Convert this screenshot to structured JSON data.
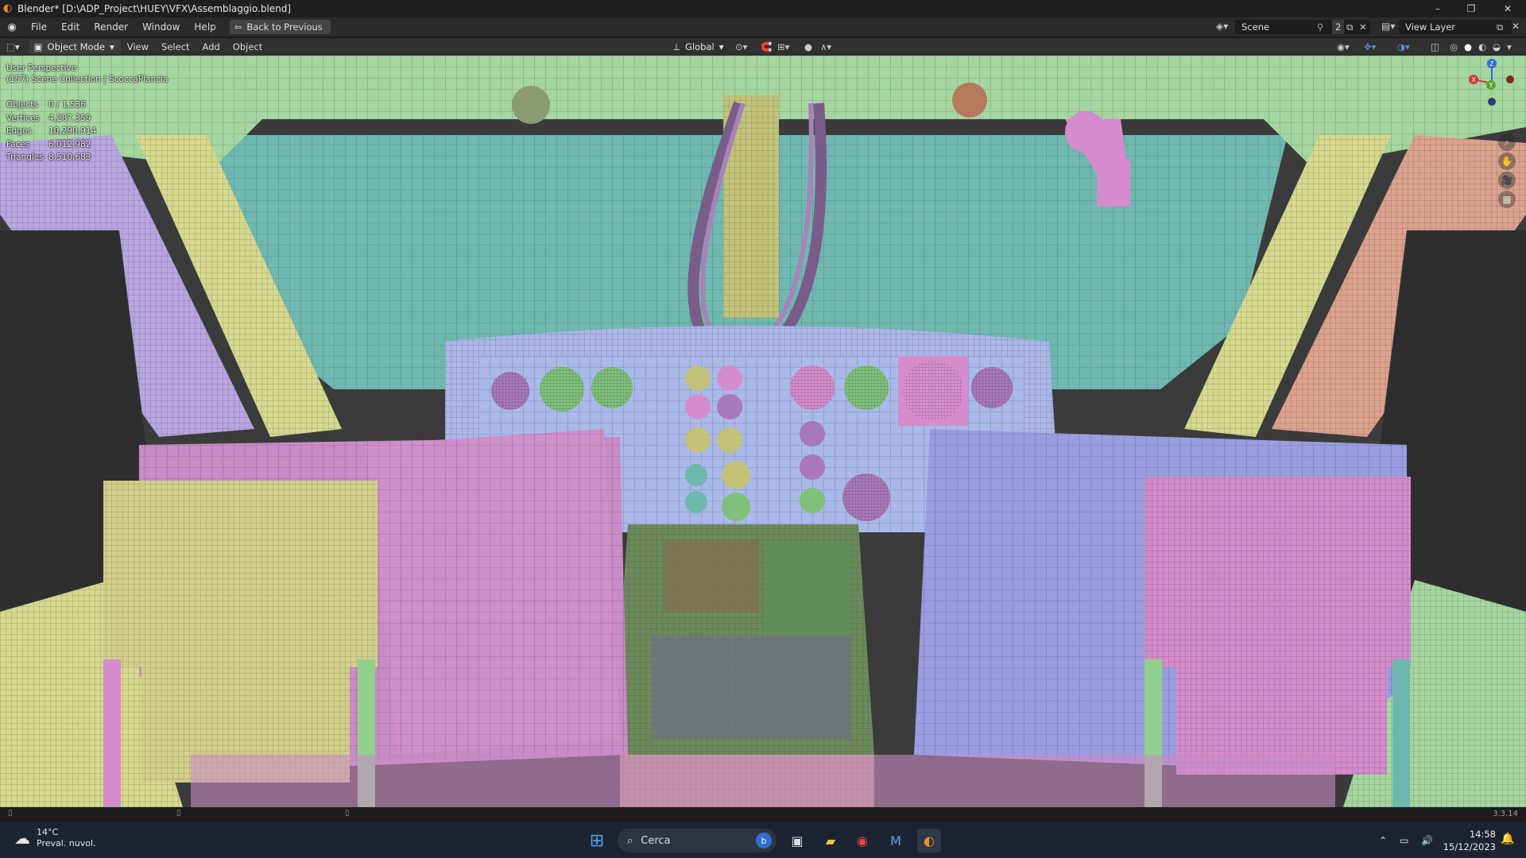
{
  "window": {
    "title": "Blender* [D:\\ADP_Project\\HUEY\\VFX\\Assemblaggio.blend]",
    "minimize": "–",
    "maximize": "❐",
    "close": "✕"
  },
  "menu": {
    "items": [
      "File",
      "Edit",
      "Render",
      "Window",
      "Help"
    ],
    "back_label": "Back to Previous",
    "scene_label": "Scene",
    "scene_users": "2",
    "view_layer_label": "View Layer"
  },
  "viewport_header": {
    "mode": "Object Mode",
    "menus": [
      "View",
      "Select",
      "Add",
      "Object"
    ],
    "orientation": "Global"
  },
  "viewport": {
    "perspective": "User Perspective",
    "collection": "(157) Scene Collection | ScoccaPlancia",
    "stats": [
      {
        "label": "Objects",
        "value": "0 / 1,536"
      },
      {
        "label": "Vertices",
        "value": "4,287,359"
      },
      {
        "label": "Edges",
        "value": "10,290,914"
      },
      {
        "label": "Faces",
        "value": "6,012,982"
      },
      {
        "label": "Triangles",
        "value": "8,510,683"
      }
    ],
    "gizmo_axes": {
      "x": "X",
      "y": "Y",
      "z": "Z"
    }
  },
  "statusbar": {
    "version": "3.3.14"
  },
  "taskbar": {
    "weather_temp": "14°C",
    "weather_desc": "Preval. nuvol.",
    "search_placeholder": "Cerca",
    "time": "14:58",
    "date": "15/12/2023"
  },
  "colors": {
    "accent_blender": "#f08c24",
    "selected_highlight": "#4772b3"
  }
}
